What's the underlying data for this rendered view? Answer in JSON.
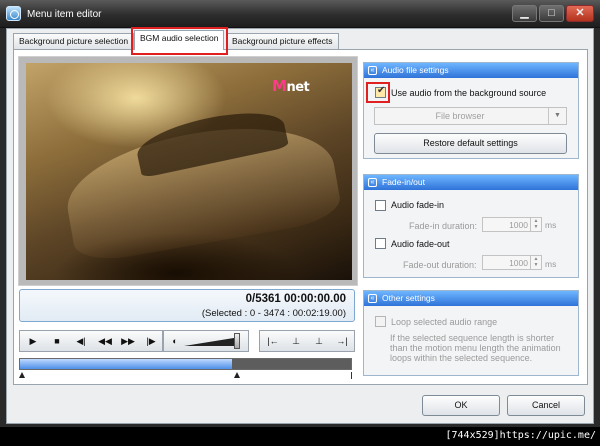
{
  "window": {
    "title": "Menu item editor",
    "min_glyph": "▁",
    "max_glyph": "□",
    "close_glyph": "✕"
  },
  "tabs": [
    {
      "label": "Background picture selection",
      "active": false
    },
    {
      "label": "BGM audio selection",
      "active": true
    },
    {
      "label": "Background picture effects",
      "active": false
    }
  ],
  "preview": {
    "logo_m": "M",
    "logo_text": "net"
  },
  "playback": {
    "frame_time": "0/5361  00:00:00.00",
    "selection": "(Selected : 0 - 3474 : 00:02:19.00)",
    "progress_fraction": 0.64
  },
  "transport": {
    "play": "▶",
    "stop": "■",
    "prev_frame": "◀|",
    "rewind": "◀◀",
    "fast_forward": "▶▶",
    "next_frame": "|▶",
    "volume_icon": "◐",
    "set_start": "|←",
    "mark_in": "⊥",
    "mark_out": "⊥",
    "set_end": "→|"
  },
  "audio_settings": {
    "header": "Audio file settings",
    "use_bg_audio_label": "Use audio from the background source",
    "use_bg_audio_checked": true,
    "file_browser": "File browser",
    "restore_defaults": "Restore default settings"
  },
  "fade": {
    "header": "Fade-in/out",
    "fade_in_label": "Audio fade-in",
    "fade_in_duration_label": "Fade-in duration:",
    "fade_in_value": "1000",
    "fade_out_label": "Audio fade-out",
    "fade_out_duration_label": "Fade-out duration:",
    "fade_out_value": "1000",
    "unit": "ms"
  },
  "other": {
    "header": "Other settings",
    "loop_label": "Loop selected audio range",
    "note_line1": "If the selected sequence length is shorter",
    "note_line2": "than the motion menu length the animation",
    "note_line3": "loops within the selected sequence."
  },
  "buttons": {
    "ok": "OK",
    "cancel": "Cancel"
  },
  "watermark": "[744x529]https://upic.me/"
}
